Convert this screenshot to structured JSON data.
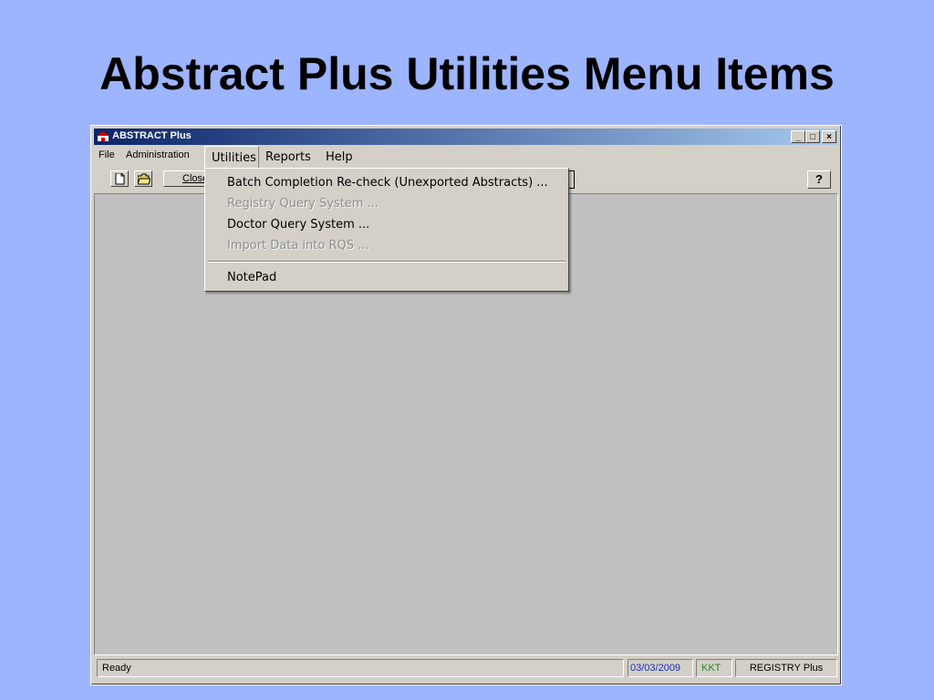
{
  "slide": {
    "title": "Abstract Plus Utilities Menu Items"
  },
  "window": {
    "title": "ABSTRACT Plus",
    "controls": {
      "minimize": "_",
      "maximize": "□",
      "close": "×"
    }
  },
  "menubar": {
    "items": [
      "File",
      "Administration",
      "Utilities",
      "Reports",
      "Help"
    ]
  },
  "toolbar": {
    "close_label": "Close",
    "help_label": "?"
  },
  "utilities_menu": {
    "items": [
      {
        "label": "Batch Completion Re-check (Unexported Abstracts) ...",
        "enabled": true
      },
      {
        "label": "Registry Query System ...",
        "enabled": false
      },
      {
        "label": "Doctor Query System ...",
        "enabled": true
      },
      {
        "label": "Import Data into RQS ...",
        "enabled": false
      },
      {
        "label": "NotePad",
        "enabled": true
      }
    ]
  },
  "statusbar": {
    "status": "Ready",
    "date": "03/03/2009",
    "user": "KKT",
    "app": "REGISTRY Plus"
  },
  "colors": {
    "slide_bg": "#9db4ff",
    "title_bar_start": "#0a246a",
    "title_bar_end": "#a6caf0",
    "date_text": "#1b2cc4",
    "user_text": "#1a8c1a"
  },
  "icons": [
    "app-icon",
    "new-document-icon",
    "open-folder-icon",
    "help-icon"
  ]
}
